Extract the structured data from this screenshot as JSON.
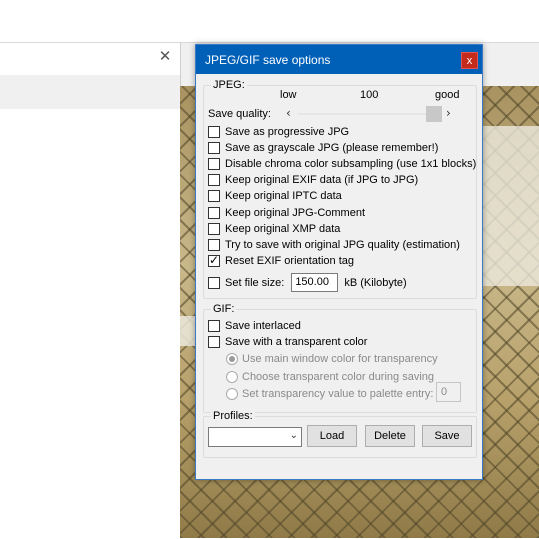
{
  "background": {
    "close_glyph": "✕"
  },
  "dialog": {
    "title": "JPEG/GIF save options",
    "close_glyph": "x",
    "jpeg": {
      "legend": "JPEG:",
      "scale_low": "low",
      "scale_mid": "100",
      "scale_high": "good",
      "quality_label": "Save quality:",
      "quality_value": 100,
      "options": [
        {
          "label": "Save as progressive JPG",
          "checked": false
        },
        {
          "label": "Save as grayscale JPG (please remember!)",
          "checked": false
        },
        {
          "label": "Disable chroma color subsampling (use 1x1 blocks)",
          "checked": false
        },
        {
          "label": "Keep original EXIF data (if JPG to JPG)",
          "checked": false
        },
        {
          "label": "Keep original IPTC data",
          "checked": false
        },
        {
          "label": "Keep original JPG-Comment",
          "checked": false
        },
        {
          "label": "Keep original XMP data",
          "checked": false
        },
        {
          "label": "Try to save with original JPG quality (estimation)",
          "checked": false
        },
        {
          "label": "Reset EXIF orientation tag",
          "checked": true
        }
      ],
      "file_size_label": "Set file size:",
      "file_size_value": "150.00",
      "file_size_unit": "kB (Kilobyte)"
    },
    "gif": {
      "legend": "GIF:",
      "interlaced_label": "Save interlaced",
      "transparent_label": "Save with a transparent color",
      "radio_main": "Use main window color for transparency",
      "radio_choose": "Choose transparent color during saving",
      "radio_palette": "Set transparency value to palette entry:",
      "palette_value": "0"
    },
    "profiles": {
      "legend": "Profiles:",
      "selected": "",
      "load_label": "Load",
      "delete_label": "Delete",
      "save_label": "Save"
    }
  },
  "icons": {
    "dropdown": "chevron-down-icon",
    "slider_left": "chevron-left-icon",
    "slider_right": "chevron-right-icon"
  },
  "colors": {
    "titlebar": "#0060b8",
    "close_button": "#c42b1c"
  }
}
